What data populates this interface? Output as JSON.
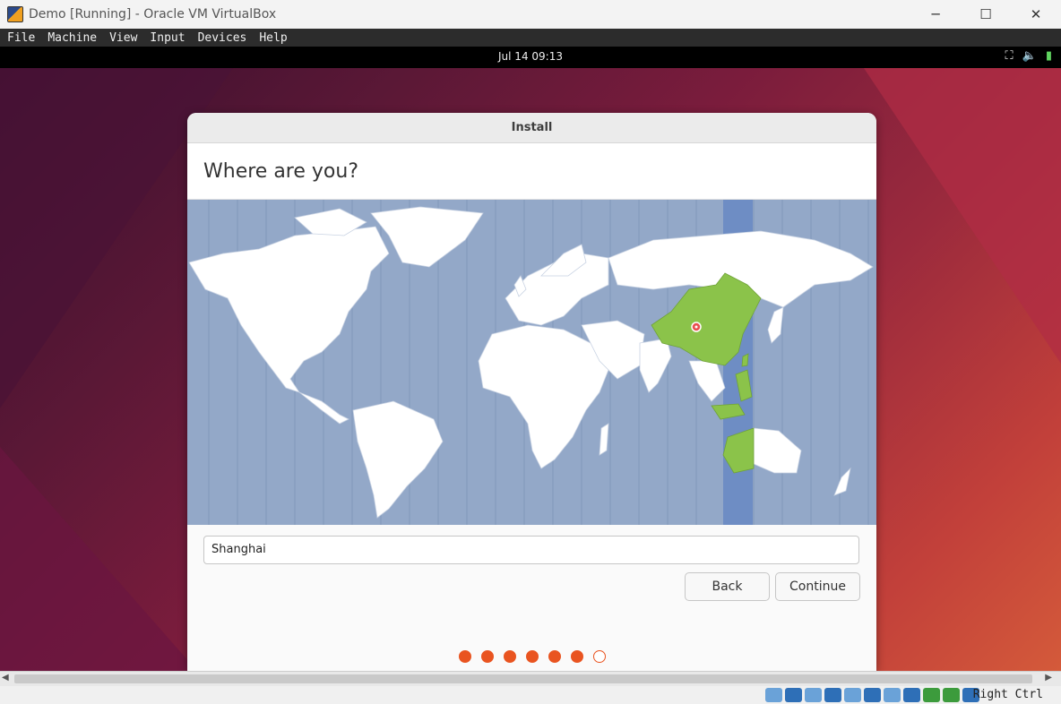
{
  "window": {
    "title": "Demo [Running] - Oracle VM VirtualBox",
    "app_icon": "virtualbox-icon",
    "controls": {
      "minimize": "─",
      "maximize": "☐",
      "close": "✕"
    }
  },
  "vb_menu": [
    "File",
    "Machine",
    "View",
    "Input",
    "Devices",
    "Help"
  ],
  "guest_topbar": {
    "clock": "Jul 14  09:13",
    "tray_icons": [
      "network-icon",
      "volume-icon",
      "battery-icon"
    ],
    "tray_glyphs": {
      "network": "⛶",
      "volume": "🔈",
      "battery": "▮"
    }
  },
  "installer": {
    "title": "Install",
    "heading": "Where are you?",
    "location_value": "Shanghai",
    "back_label": "Back",
    "continue_label": "Continue",
    "steps_total": 7,
    "steps_completed": 6,
    "selected_timezone_color": "#8bc34a",
    "accent_color": "#e95420"
  },
  "vb_status": {
    "host_key": "Right Ctrl",
    "scroll_left": "◀",
    "scroll_right": "▶",
    "icons": [
      "optical-drive-icon",
      "hard-disk-icon",
      "audio-icon",
      "network-adapter-icon",
      "usb-icon",
      "shared-folders-icon",
      "display-icon",
      "video-capture-icon",
      "recording-icon",
      "cpu-icon",
      "mouse-integration-icon",
      "keyboard-icon"
    ]
  }
}
